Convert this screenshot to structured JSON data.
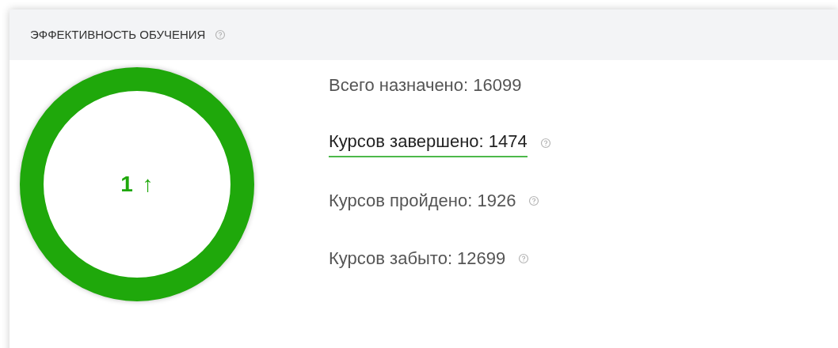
{
  "card": {
    "title": "ЭФФЕКТИВНОСТЬ ОБУЧЕНИЯ",
    "help": true
  },
  "ring": {
    "value": "1",
    "arrow": "↑"
  },
  "stats": [
    {
      "text": "Всего назначено: 16099",
      "selected": false,
      "help": false
    },
    {
      "text": "Курсов завершено: 1474",
      "selected": true,
      "help": true
    },
    {
      "text": "Курсов пройдено: 1926",
      "selected": false,
      "help": true
    },
    {
      "text": "Курсов забыто: 12699",
      "selected": false,
      "help": true
    }
  ]
}
